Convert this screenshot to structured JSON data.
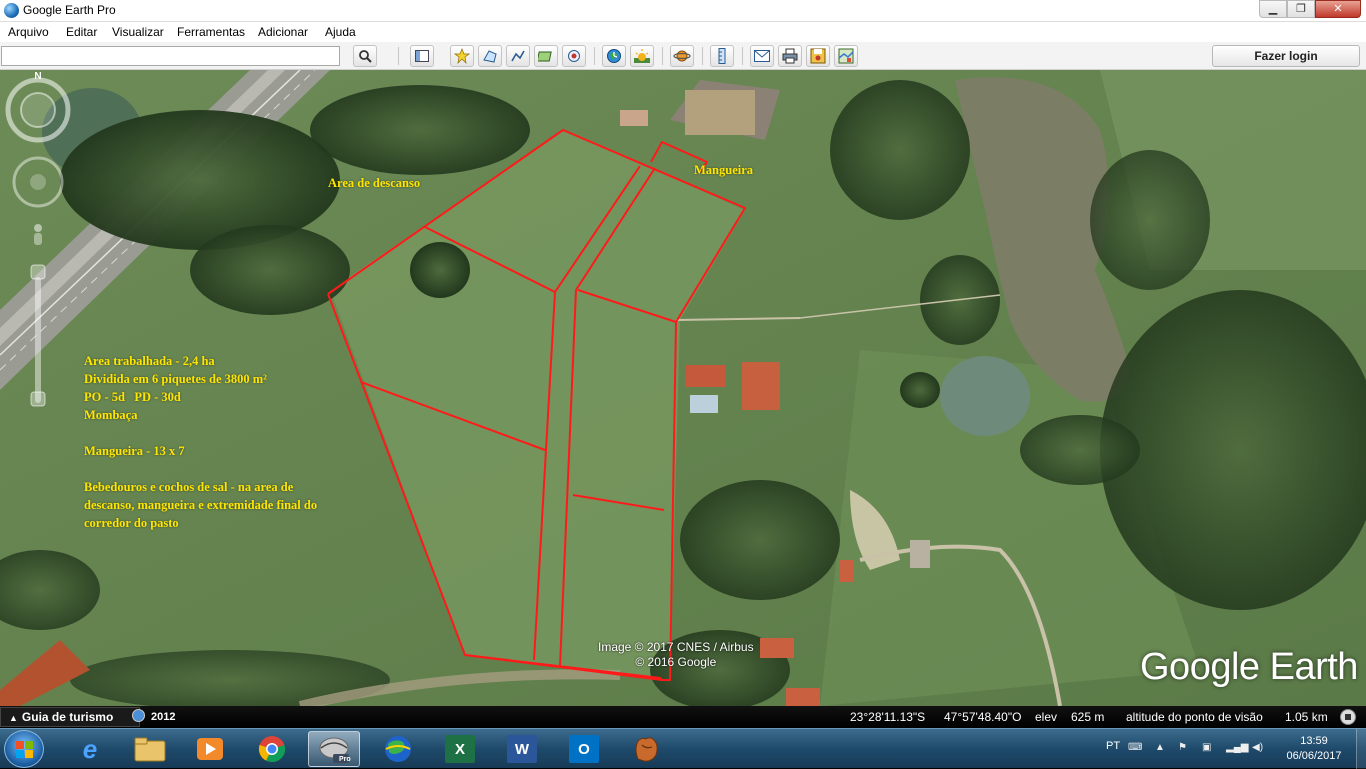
{
  "window": {
    "title": "Google Earth Pro",
    "min_glyph": "▁",
    "max_glyph": "❐",
    "close_glyph": "✕"
  },
  "menu": [
    "Arquivo",
    "Editar",
    "Visualizar",
    "Ferramentas",
    "Adicionar",
    "Ajuda"
  ],
  "toolbar": {
    "search_value": "",
    "search_placeholder": "",
    "login_label": "Fazer login",
    "icons": [
      "search-icon",
      "sidebar-icon",
      "placemark-icon",
      "polygon-icon",
      "path-icon",
      "overlay-icon",
      "record-tour-icon",
      "historical-imagery-icon",
      "sunlight-icon",
      "planets-icon",
      "ruler-icon",
      "email-icon",
      "print-icon",
      "save-image-icon",
      "view-in-maps-icon"
    ]
  },
  "map": {
    "labels": {
      "rest_area": "Area de descanso",
      "corral": "Mangueira"
    },
    "notes": [
      "Area trabalhada - 2,4 ha",
      "Dividida em 6 piquetes de 3800 m²",
      "PO - 5d   PD - 30d",
      "Mombaça",
      "",
      "Mangueira - 13 x 7",
      "",
      "Bebedouros e cochos de sal - na area de descanso, mangueira e extremidade final do corredor do pasto"
    ],
    "attribution_line1": "Image © 2017 CNES / Airbus",
    "attribution_line2": "© 2016 Google",
    "brand": "Google Earth",
    "compass_letter": "N",
    "paddock_line_color": "#ff1a1a",
    "label_color": "#ffe600"
  },
  "status": {
    "tour_guide": "Guia de turismo",
    "year": "2012",
    "latitude": "23°28'11.13\"S",
    "longitude": "47°57'48.40\"O",
    "elev_label": "elev",
    "elev_value": "625 m",
    "eye_alt_label": "altitude do ponto de visão",
    "eye_alt_value": "1.05 km"
  },
  "taskbar": {
    "apps": [
      "internet-explorer",
      "file-explorer",
      "media-player",
      "chrome",
      "google-earth-pro",
      "globe-app",
      "excel",
      "word",
      "outlook",
      "baseball-app"
    ],
    "active_app": "google-earth-pro",
    "earth_badge": "Pro",
    "language": "PT",
    "time": "13:59",
    "date": "06/06/2017"
  }
}
